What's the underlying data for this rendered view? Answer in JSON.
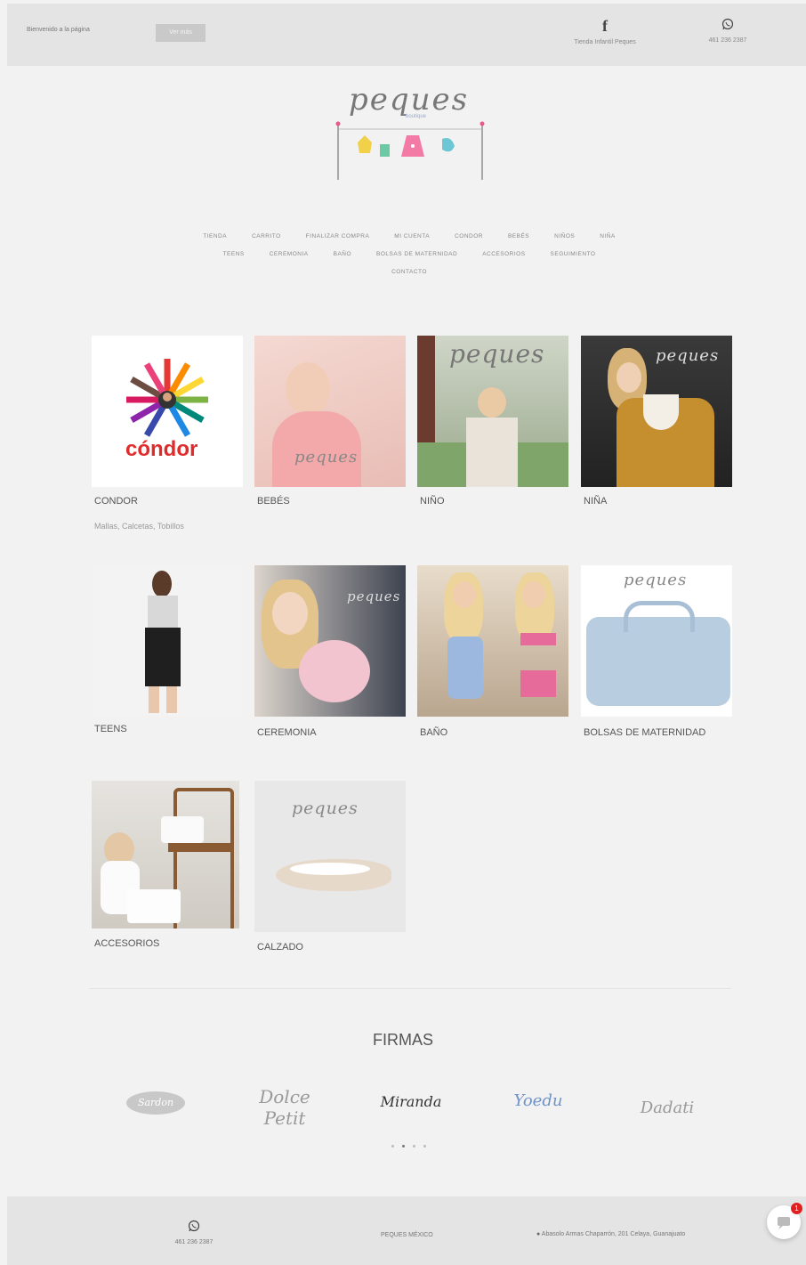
{
  "topbar": {
    "login_text": "Bienvenido a la página",
    "login_button": "Ver más",
    "facebook_label": "Tienda Infantil Peques",
    "whatsapp_label": "461 236 2387"
  },
  "logo": {
    "word": "peques",
    "sub": "boutique"
  },
  "nav": {
    "row1": [
      "TIENDA",
      "CARRITO",
      "FINALIZAR COMPRA",
      "MI CUENTA",
      "CONDOR",
      "BEBÉS",
      "NIÑOS",
      "NIÑA"
    ],
    "row2": [
      "TEENS",
      "CEREMONIA",
      "BAÑO",
      "BOLSAS DE MATERNIDAD",
      "ACCESORIOS",
      "SEGUIMIENTO"
    ],
    "row3": [
      "CONTACTO"
    ]
  },
  "categories": [
    {
      "label": "CONDOR",
      "sub": "Mallas, Calcetas, Tobillos",
      "watermark": "",
      "brand": "cóndor"
    },
    {
      "label": "BEBÉS",
      "watermark": "peques"
    },
    {
      "label": "NIÑO",
      "watermark": "peques"
    },
    {
      "label": "NIÑA",
      "watermark": "peques"
    },
    {
      "label": "TEENS",
      "watermark": ""
    },
    {
      "label": "CEREMONIA",
      "watermark": "peques"
    },
    {
      "label": "BAÑO",
      "watermark": ""
    },
    {
      "label": "BOLSAS DE MATERNIDAD",
      "watermark": "peques"
    },
    {
      "label": "ACCESORIOS",
      "watermark": ""
    },
    {
      "label": "CALZADO",
      "watermark": "peques"
    }
  ],
  "firmas": {
    "title": "FIRMAS",
    "brands": [
      "Sardon",
      "Dolce Petit",
      "Miranda",
      "Yoedu",
      "Dadati"
    ]
  },
  "footer": {
    "phone": "461 236 2387",
    "name": "PEQUES MÉXICO",
    "address": "Abasolo Armas Chaparrón, 201 Celaya, Guanajuato"
  },
  "chat": {
    "badge": "1"
  },
  "colors": {
    "topbar": "#e4e4e4",
    "background": "#f2f2f2",
    "badge": "#e02020"
  }
}
